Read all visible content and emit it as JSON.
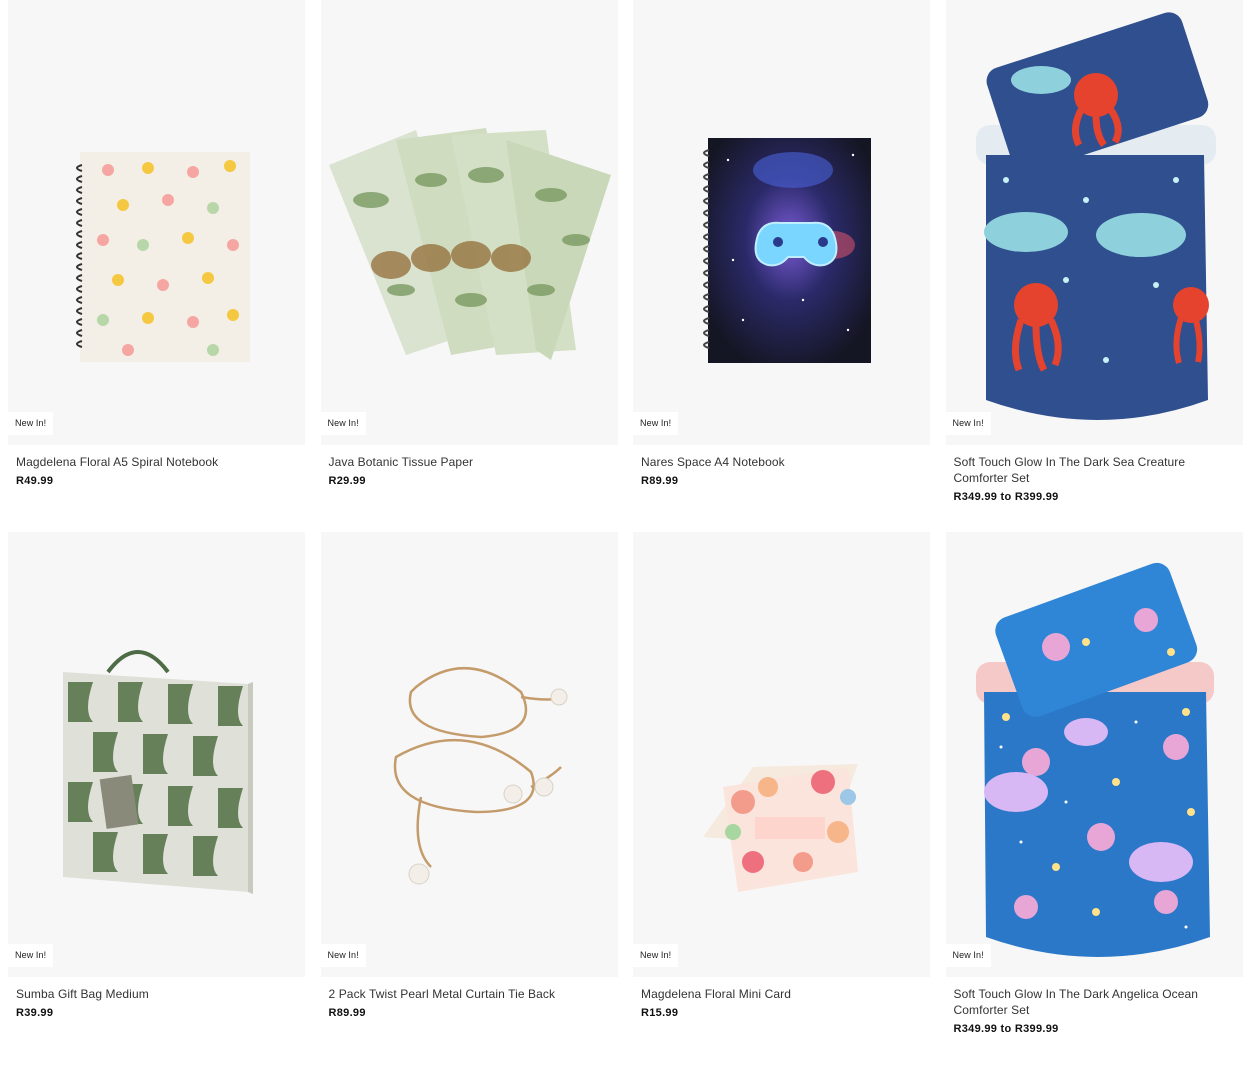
{
  "products": [
    {
      "name": "Magdelena Floral A5 Spiral Notebook",
      "price": "R49.99",
      "badge": "New In!",
      "image": "floral-notebook-image"
    },
    {
      "name": "Java Botanic Tissue Paper",
      "price": "R29.99",
      "badge": "New In!",
      "image": "botanic-tissue-paper-image"
    },
    {
      "name": "Nares Space A4 Notebook",
      "price": "R89.99",
      "badge": "New In!",
      "image": "space-notebook-image"
    },
    {
      "name": "Soft Touch Glow In The Dark Sea Creature Comforter Set",
      "price": "R349.99 to R399.99",
      "badge": "New In!",
      "image": "sea-creature-comforter-image"
    },
    {
      "name": "Sumba Gift Bag Medium",
      "price": "R39.99",
      "badge": "New In!",
      "image": "gift-bag-image"
    },
    {
      "name": "2 Pack Twist Pearl Metal Curtain Tie Back",
      "price": "R89.99",
      "badge": "New In!",
      "image": "pearl-tie-back-image"
    },
    {
      "name": "Magdelena Floral Mini Card",
      "price": "R15.99",
      "badge": "New In!",
      "image": "floral-mini-card-image"
    },
    {
      "name": "Soft Touch Glow In The Dark Angelica Ocean Comforter Set",
      "price": "R349.99 to R399.99",
      "badge": "New In!",
      "image": "ocean-comforter-image"
    }
  ],
  "colors": {
    "image_bg": "#f7f7f7",
    "badge_bg": "#ffffff",
    "text": "#333333",
    "price": "#111111"
  }
}
